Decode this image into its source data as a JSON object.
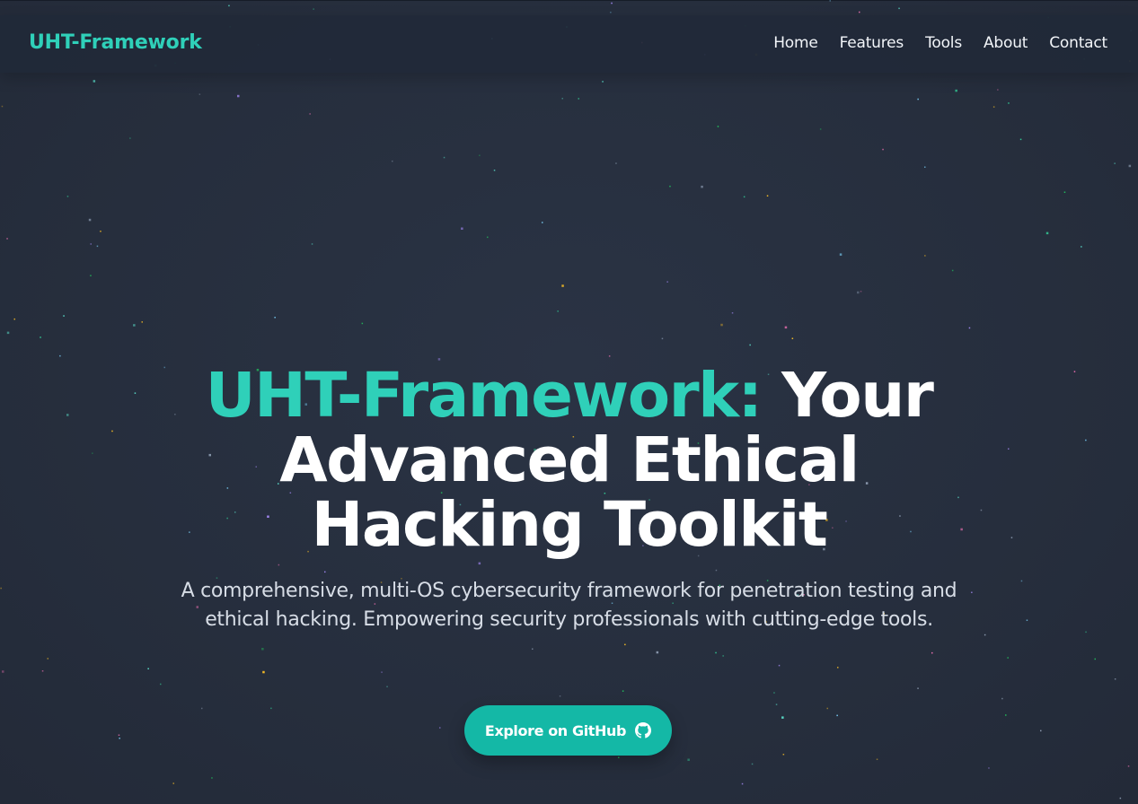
{
  "nav": {
    "brand": "UHT-Framework",
    "links": [
      "Home",
      "Features",
      "Tools",
      "About",
      "Contact"
    ]
  },
  "hero": {
    "title_accent": "UHT-Framework:",
    "title_rest": " Your Advanced Ethical Hacking Toolkit",
    "subtitle": "A comprehensive, multi-OS cybersecurity framework for penetration testing and ethical hacking. Empowering security professionals with cutting-edge tools.",
    "cta_label": "Explore on GitHub",
    "cta_icon": "github-icon"
  },
  "colors": {
    "background": "#272f3f",
    "navbar": "#212938",
    "accent": "#2fd0b9",
    "button": "#14b8a6",
    "text": "#ffffff",
    "subtext": "#d7dde6"
  }
}
